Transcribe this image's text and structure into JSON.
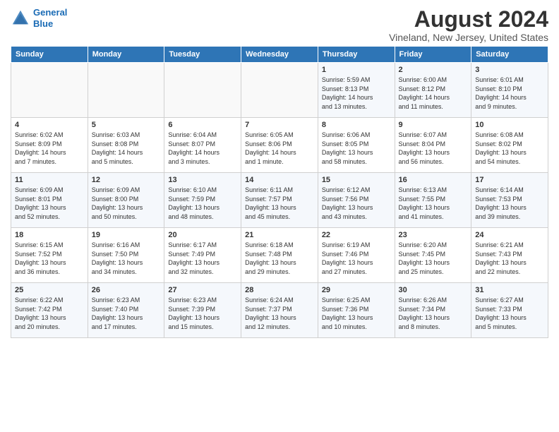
{
  "header": {
    "logo_line1": "General",
    "logo_line2": "Blue",
    "title": "August 2024",
    "subtitle": "Vineland, New Jersey, United States"
  },
  "weekdays": [
    "Sunday",
    "Monday",
    "Tuesday",
    "Wednesday",
    "Thursday",
    "Friday",
    "Saturday"
  ],
  "weeks": [
    [
      {
        "day": "",
        "info": ""
      },
      {
        "day": "",
        "info": ""
      },
      {
        "day": "",
        "info": ""
      },
      {
        "day": "",
        "info": ""
      },
      {
        "day": "1",
        "info": "Sunrise: 5:59 AM\nSunset: 8:13 PM\nDaylight: 14 hours\nand 13 minutes."
      },
      {
        "day": "2",
        "info": "Sunrise: 6:00 AM\nSunset: 8:12 PM\nDaylight: 14 hours\nand 11 minutes."
      },
      {
        "day": "3",
        "info": "Sunrise: 6:01 AM\nSunset: 8:10 PM\nDaylight: 14 hours\nand 9 minutes."
      }
    ],
    [
      {
        "day": "4",
        "info": "Sunrise: 6:02 AM\nSunset: 8:09 PM\nDaylight: 14 hours\nand 7 minutes."
      },
      {
        "day": "5",
        "info": "Sunrise: 6:03 AM\nSunset: 8:08 PM\nDaylight: 14 hours\nand 5 minutes."
      },
      {
        "day": "6",
        "info": "Sunrise: 6:04 AM\nSunset: 8:07 PM\nDaylight: 14 hours\nand 3 minutes."
      },
      {
        "day": "7",
        "info": "Sunrise: 6:05 AM\nSunset: 8:06 PM\nDaylight: 14 hours\nand 1 minute."
      },
      {
        "day": "8",
        "info": "Sunrise: 6:06 AM\nSunset: 8:05 PM\nDaylight: 13 hours\nand 58 minutes."
      },
      {
        "day": "9",
        "info": "Sunrise: 6:07 AM\nSunset: 8:04 PM\nDaylight: 13 hours\nand 56 minutes."
      },
      {
        "day": "10",
        "info": "Sunrise: 6:08 AM\nSunset: 8:02 PM\nDaylight: 13 hours\nand 54 minutes."
      }
    ],
    [
      {
        "day": "11",
        "info": "Sunrise: 6:09 AM\nSunset: 8:01 PM\nDaylight: 13 hours\nand 52 minutes."
      },
      {
        "day": "12",
        "info": "Sunrise: 6:09 AM\nSunset: 8:00 PM\nDaylight: 13 hours\nand 50 minutes."
      },
      {
        "day": "13",
        "info": "Sunrise: 6:10 AM\nSunset: 7:59 PM\nDaylight: 13 hours\nand 48 minutes."
      },
      {
        "day": "14",
        "info": "Sunrise: 6:11 AM\nSunset: 7:57 PM\nDaylight: 13 hours\nand 45 minutes."
      },
      {
        "day": "15",
        "info": "Sunrise: 6:12 AM\nSunset: 7:56 PM\nDaylight: 13 hours\nand 43 minutes."
      },
      {
        "day": "16",
        "info": "Sunrise: 6:13 AM\nSunset: 7:55 PM\nDaylight: 13 hours\nand 41 minutes."
      },
      {
        "day": "17",
        "info": "Sunrise: 6:14 AM\nSunset: 7:53 PM\nDaylight: 13 hours\nand 39 minutes."
      }
    ],
    [
      {
        "day": "18",
        "info": "Sunrise: 6:15 AM\nSunset: 7:52 PM\nDaylight: 13 hours\nand 36 minutes."
      },
      {
        "day": "19",
        "info": "Sunrise: 6:16 AM\nSunset: 7:50 PM\nDaylight: 13 hours\nand 34 minutes."
      },
      {
        "day": "20",
        "info": "Sunrise: 6:17 AM\nSunset: 7:49 PM\nDaylight: 13 hours\nand 32 minutes."
      },
      {
        "day": "21",
        "info": "Sunrise: 6:18 AM\nSunset: 7:48 PM\nDaylight: 13 hours\nand 29 minutes."
      },
      {
        "day": "22",
        "info": "Sunrise: 6:19 AM\nSunset: 7:46 PM\nDaylight: 13 hours\nand 27 minutes."
      },
      {
        "day": "23",
        "info": "Sunrise: 6:20 AM\nSunset: 7:45 PM\nDaylight: 13 hours\nand 25 minutes."
      },
      {
        "day": "24",
        "info": "Sunrise: 6:21 AM\nSunset: 7:43 PM\nDaylight: 13 hours\nand 22 minutes."
      }
    ],
    [
      {
        "day": "25",
        "info": "Sunrise: 6:22 AM\nSunset: 7:42 PM\nDaylight: 13 hours\nand 20 minutes."
      },
      {
        "day": "26",
        "info": "Sunrise: 6:23 AM\nSunset: 7:40 PM\nDaylight: 13 hours\nand 17 minutes."
      },
      {
        "day": "27",
        "info": "Sunrise: 6:23 AM\nSunset: 7:39 PM\nDaylight: 13 hours\nand 15 minutes."
      },
      {
        "day": "28",
        "info": "Sunrise: 6:24 AM\nSunset: 7:37 PM\nDaylight: 13 hours\nand 12 minutes."
      },
      {
        "day": "29",
        "info": "Sunrise: 6:25 AM\nSunset: 7:36 PM\nDaylight: 13 hours\nand 10 minutes."
      },
      {
        "day": "30",
        "info": "Sunrise: 6:26 AM\nSunset: 7:34 PM\nDaylight: 13 hours\nand 8 minutes."
      },
      {
        "day": "31",
        "info": "Sunrise: 6:27 AM\nSunset: 7:33 PM\nDaylight: 13 hours\nand 5 minutes."
      }
    ]
  ]
}
